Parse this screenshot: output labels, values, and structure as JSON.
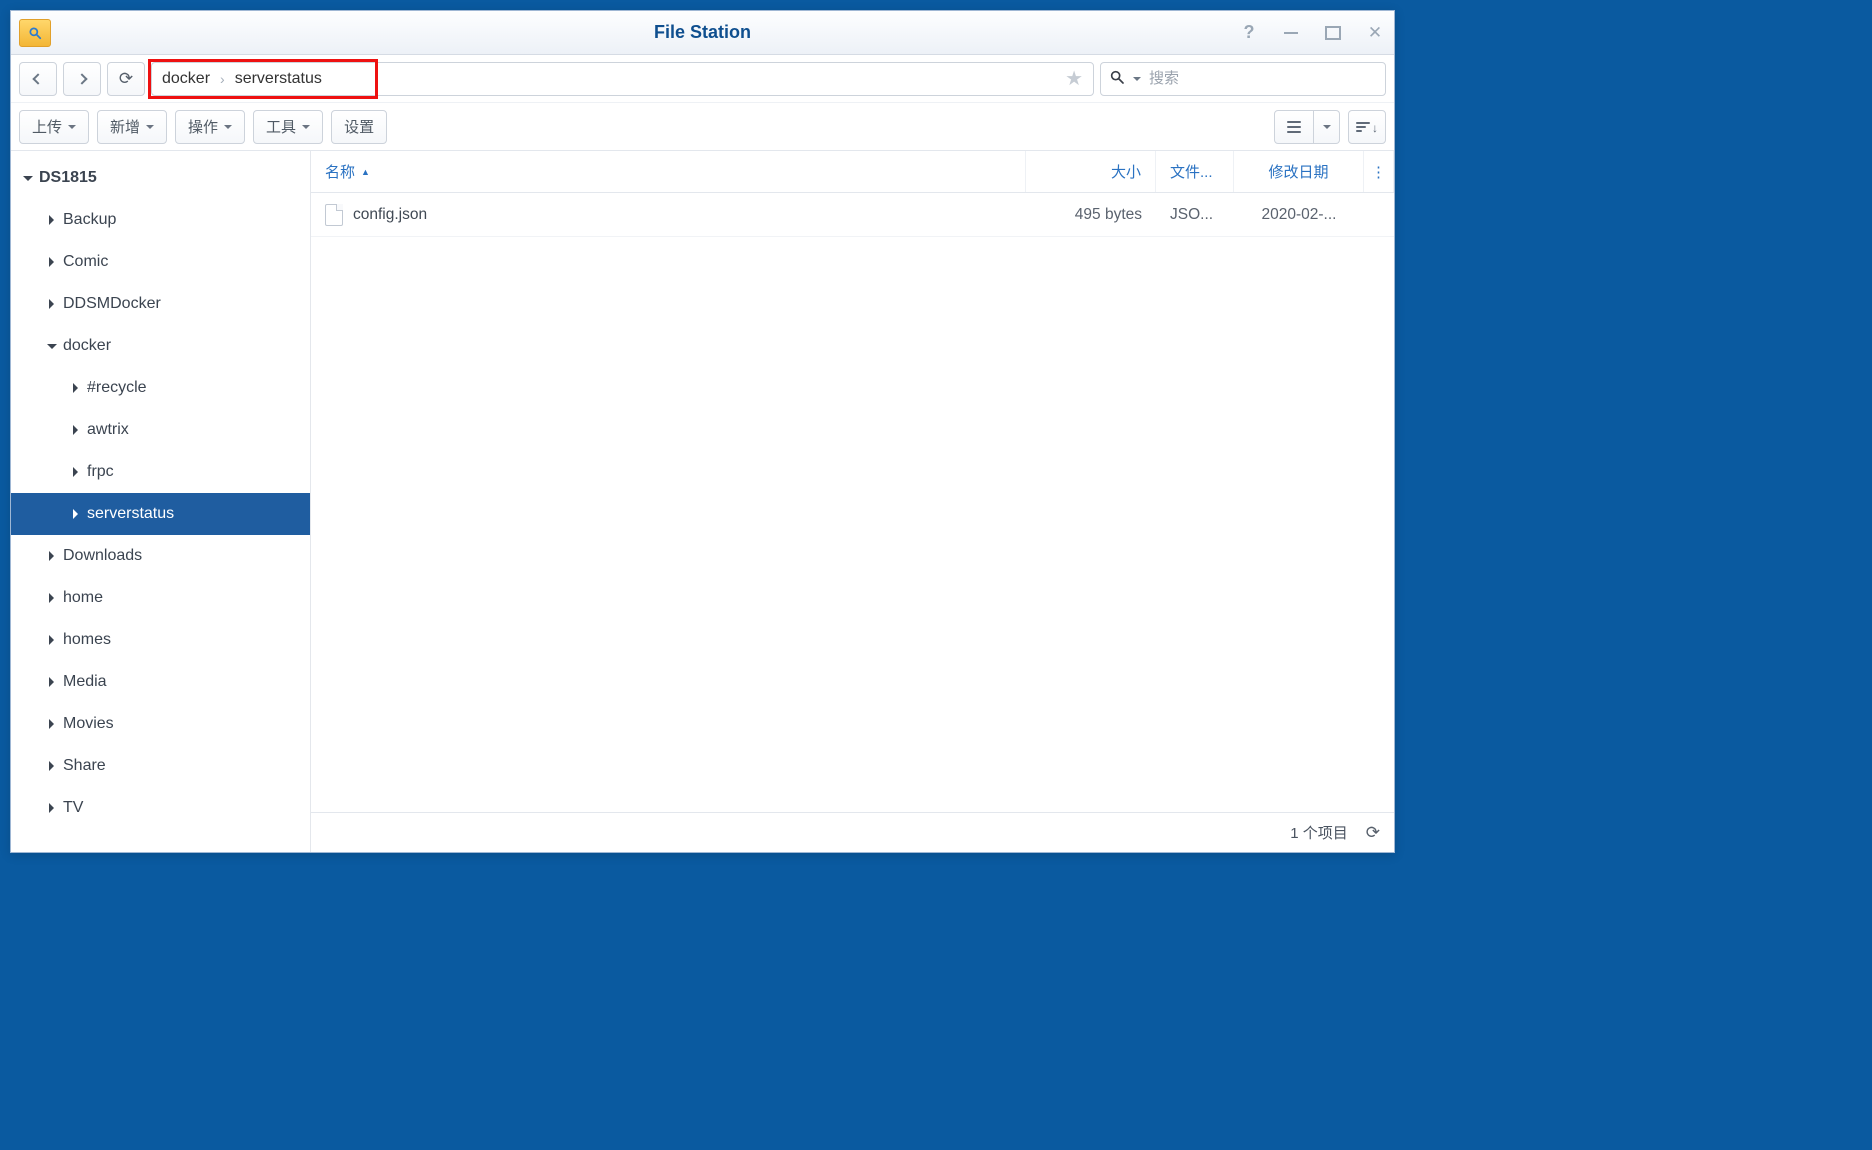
{
  "window": {
    "title": "File Station"
  },
  "breadcrumb": {
    "segments": [
      "docker",
      "serverstatus"
    ]
  },
  "search": {
    "placeholder": "搜索"
  },
  "toolbar": {
    "upload": "上传",
    "create": "新增",
    "action": "操作",
    "tools": "工具",
    "settings": "设置"
  },
  "columns": {
    "name": "名称",
    "size": "大小",
    "type": "文件...",
    "date": "修改日期"
  },
  "tree": {
    "root": "DS1815",
    "level1": {
      "0": "Backup",
      "1": "Comic",
      "2": "DDSMDocker",
      "3": "docker",
      "4": "Downloads",
      "5": "home",
      "6": "homes",
      "7": "Media",
      "8": "Movies",
      "9": "Share",
      "10": "TV"
    },
    "docker_children": {
      "0": "#recycle",
      "1": "awtrix",
      "2": "frpc",
      "3": "serverstatus"
    }
  },
  "files": [
    {
      "name": "config.json",
      "size": "495 bytes",
      "type": "JSO...",
      "date": "2020-02-..."
    }
  ],
  "status": {
    "count": "1 个项目"
  }
}
